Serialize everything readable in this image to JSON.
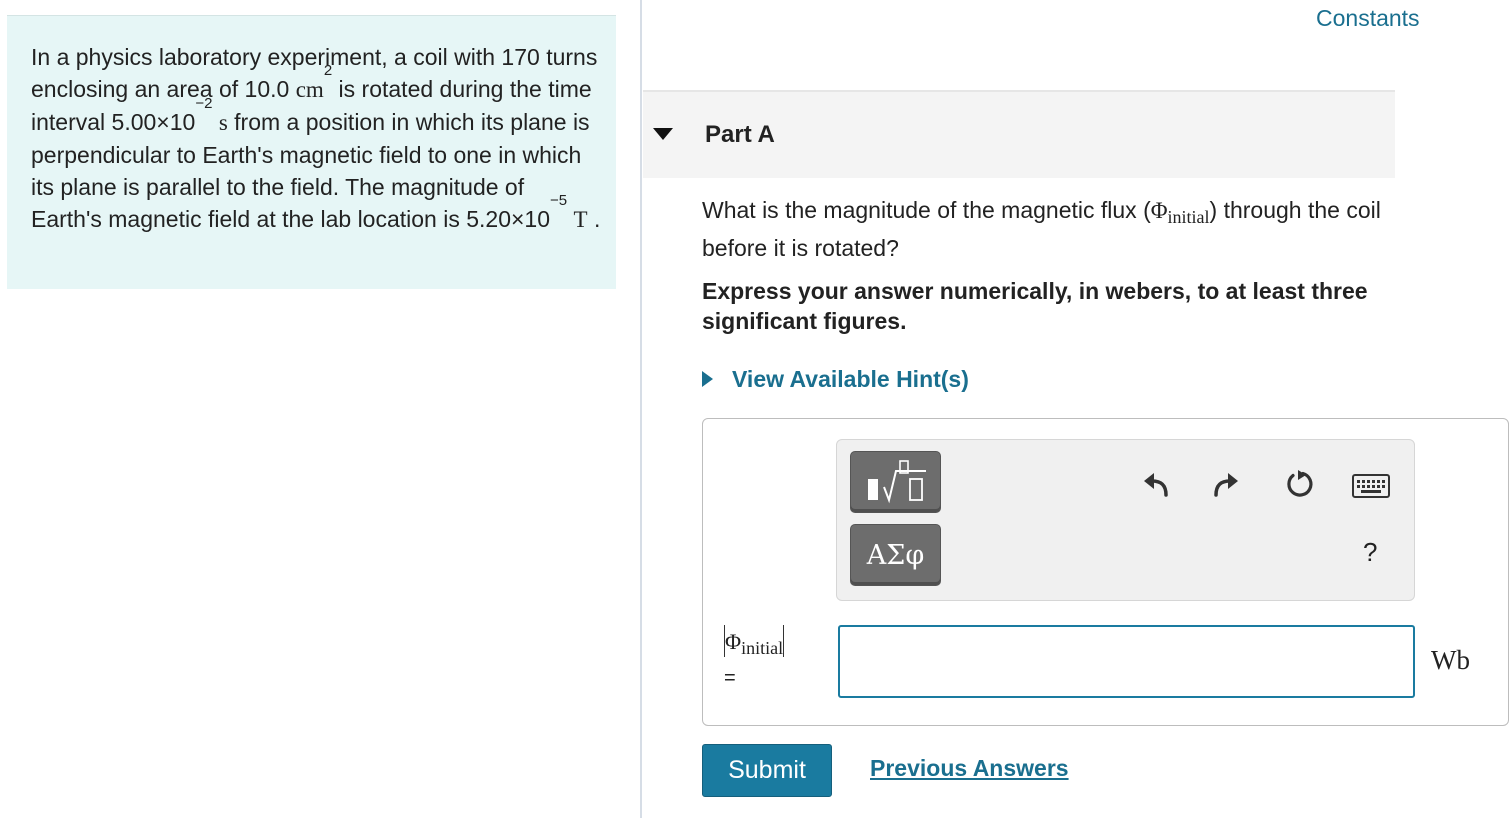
{
  "problem": {
    "segments": [
      "In a physics laboratory experiment, a coil with 170 turns enclosing an area of 10.0 ",
      "cm",
      "2",
      " is rotated during the time interval 5.00×10",
      "−2",
      "s",
      " from a position in which its plane is perpendicular to Earth's magnetic field to one in which its plane is parallel to the field. The magnitude of Earth's magnetic field at the lab location is 5.20×10",
      "−5",
      "T",
      " ."
    ]
  },
  "header": {
    "constants_label": "Constants"
  },
  "part": {
    "title": "Part A",
    "question_before": "What is the magnitude of the magnetic flux (",
    "question_symbol": "Φ",
    "question_subscript": "initial",
    "question_after": ") through the coil before it is rotated?",
    "instruction": "Express your answer numerically, in webers, to at least three significant figures.",
    "hint_label": "View Available Hint(s)"
  },
  "toolbar": {
    "symbols_label": "ΑΣφ",
    "help_label": "?",
    "icons": [
      "templates-icon",
      "undo-icon",
      "redo-icon",
      "reset-icon",
      "keyboard-icon"
    ]
  },
  "answer": {
    "label_symbol": "Φ",
    "label_subscript": "initial",
    "equals": "=",
    "value": "",
    "unit": "Wb"
  },
  "actions": {
    "submit_label": "Submit",
    "previous_answers_label": "Previous Answers"
  },
  "colors": {
    "accent": "#1a7ba0",
    "link": "#1a6f8f",
    "problem_bg": "#e6f6f6"
  }
}
